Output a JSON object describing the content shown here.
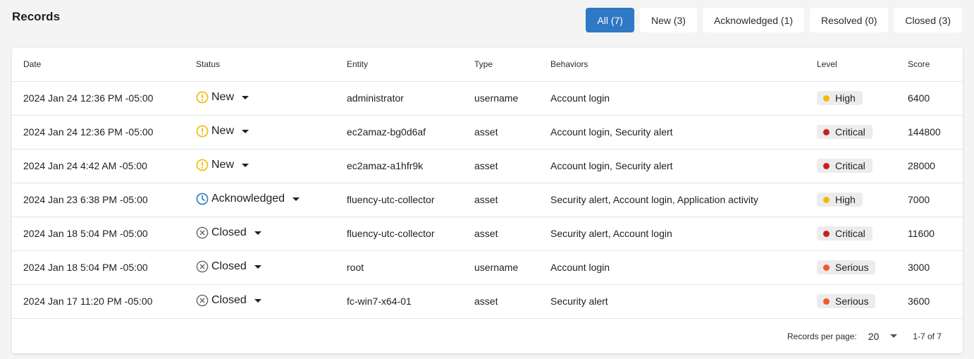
{
  "page": {
    "title": "Records"
  },
  "filters": [
    {
      "label": "All (7)",
      "active": true
    },
    {
      "label": "New (3)",
      "active": false
    },
    {
      "label": "Acknowledged (1)",
      "active": false
    },
    {
      "label": "Resolved (0)",
      "active": false
    },
    {
      "label": "Closed (3)",
      "active": false
    }
  ],
  "table": {
    "columns": [
      "Date",
      "Status",
      "Entity",
      "Type",
      "Behaviors",
      "Level",
      "Score"
    ],
    "rows": [
      {
        "date": "2024 Jan 24 12:36 PM -05:00",
        "status": "New",
        "status_icon": "exclamation-circle-icon",
        "entity": "administrator",
        "type": "username",
        "behaviors": "Account login",
        "level": "High",
        "score": "6400"
      },
      {
        "date": "2024 Jan 24 12:36 PM -05:00",
        "status": "New",
        "status_icon": "exclamation-circle-icon",
        "entity": "ec2amaz-bg0d6af",
        "type": "asset",
        "behaviors": "Account login, Security alert",
        "level": "Critical",
        "score": "144800"
      },
      {
        "date": "2024 Jan 24 4:42 AM -05:00",
        "status": "New",
        "status_icon": "exclamation-circle-icon",
        "entity": "ec2amaz-a1hfr9k",
        "type": "asset",
        "behaviors": "Account login, Security alert",
        "level": "Critical",
        "score": "28000"
      },
      {
        "date": "2024 Jan 23 6:38 PM -05:00",
        "status": "Acknowledged",
        "status_icon": "clock-icon",
        "entity": "fluency-utc-collector",
        "type": "asset",
        "behaviors": "Security alert, Account login, Application activity",
        "level": "High",
        "score": "7000"
      },
      {
        "date": "2024 Jan 18 5:04 PM -05:00",
        "status": "Closed",
        "status_icon": "x-circle-icon",
        "entity": "fluency-utc-collector",
        "type": "asset",
        "behaviors": "Security alert, Account login",
        "level": "Critical",
        "score": "11600"
      },
      {
        "date": "2024 Jan 18 5:04 PM -05:00",
        "status": "Closed",
        "status_icon": "x-circle-icon",
        "entity": "root",
        "type": "username",
        "behaviors": "Account login",
        "level": "Serious",
        "score": "3000"
      },
      {
        "date": "2024 Jan 17 11:20 PM -05:00",
        "status": "Closed",
        "status_icon": "x-circle-icon",
        "entity": "fc-win7-x64-01",
        "type": "asset",
        "behaviors": "Security alert",
        "level": "Serious",
        "score": "3600"
      }
    ]
  },
  "level_colors": {
    "High": "#f5b800",
    "Critical": "#c62020",
    "Serious": "#f2592a"
  },
  "status_colors": {
    "New": "#f5b800",
    "Acknowledged": "#2f78c5",
    "Closed": "#666666"
  },
  "pagination": {
    "rows_per_page_label": "Records per page:",
    "rows_per_page": "20",
    "range": "1-7 of 7"
  }
}
